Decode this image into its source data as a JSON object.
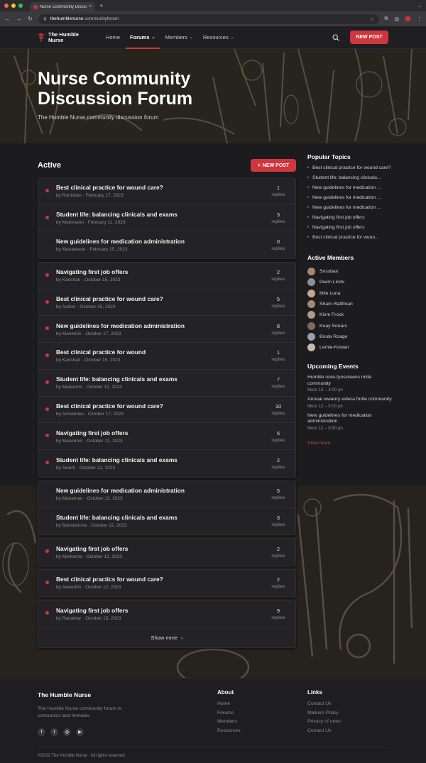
{
  "browser": {
    "tab_title": "Nurse Community Discussio",
    "tab_close": "×",
    "new_tab": "+",
    "url_domain": "thehumblenurse",
    "url_rest": ".communityforum"
  },
  "header": {
    "brand": "The Humble Nurse",
    "nav": [
      {
        "label": "Home"
      },
      {
        "label": "Forums"
      },
      {
        "label": "Members"
      },
      {
        "label": "Resources"
      }
    ],
    "new_post": "NEW POST"
  },
  "hero": {
    "title": "Nurse Community Discussion Forum",
    "subtitle": "The Humble Nurse community discussion forum"
  },
  "feed": {
    "title": "Active",
    "new_post": "NEW POST",
    "replies_label": "replies",
    "groups": [
      [
        {
          "title": "Best clinical practice for wound care?",
          "author": "Ronistian",
          "date": "February 17, 2023",
          "count": "1",
          "unread": true
        },
        {
          "title": "Student life: balancing clinicals and exams",
          "author": "Maoknann",
          "date": "February 11, 2023",
          "count": "3",
          "unread": true
        },
        {
          "title": "New guidelines for medication administration",
          "author": "Manawasin",
          "date": "February 15, 2023",
          "count": "0",
          "unread": false
        }
      ],
      [
        {
          "title": "Navigating first job offers",
          "author": "Kanshan",
          "date": "October 15, 2023",
          "count": "2",
          "unread": true
        },
        {
          "title": "Best clinical practice for wound care?",
          "author": "Author",
          "date": "October 15, 2023",
          "count": "5",
          "unread": true
        },
        {
          "title": "New guidelines for medication administration",
          "author": "Manemin",
          "date": "October 17, 2023",
          "count": "8",
          "unread": true
        },
        {
          "title": "Best clinical practice for wound",
          "author": "Kanshan",
          "date": "October 15, 2023",
          "count": "1",
          "unread": true
        },
        {
          "title": "Student life: balancing clinicals and exams",
          "author": "Maikamm",
          "date": "October 12, 2023",
          "count": "7",
          "unread": true
        },
        {
          "title": "Best clinical practice for wound care?",
          "author": "Annventex",
          "date": "October 17, 2023",
          "count": "10",
          "unread": true
        },
        {
          "title": "Navigating first job offers",
          "author": "Marxamm",
          "date": "October 12, 2023",
          "count": "5",
          "unread": true
        },
        {
          "title": "Student life: balancing clinicals and exams",
          "author": "Swerh",
          "date": "October 12, 2023",
          "count": "2",
          "unread": true
        }
      ],
      [
        {
          "title": "New guidelines for medication administration",
          "author": "Maneman",
          "date": "October 12, 2023",
          "count": "5",
          "unread": false
        },
        {
          "title": "Student life: balancing clinicals and exams",
          "author": "Banstomme",
          "date": "October 12, 2023",
          "count": "3",
          "unread": false
        }
      ],
      [
        {
          "title": "Navigating first job offers",
          "author": "Markamis",
          "date": "October 12, 2023",
          "count": "2",
          "unread": true
        }
      ],
      [
        {
          "title": "Best clinical practics for wound care?",
          "author": "Awearttin",
          "date": "October 12, 2023",
          "count": "2",
          "unread": true
        }
      ],
      [
        {
          "title": "Navigating first job offers",
          "author": "Ranathar",
          "date": "October 15, 2023",
          "count": "9",
          "unread": true
        }
      ]
    ],
    "show_more": "Show mme"
  },
  "sidebar": {
    "popular_title": "Popular Topics",
    "popular": [
      "Best clinical practice for wound care?",
      "Student life: balancing clinicals...",
      "New guidelines for medication ...",
      "New guidelines for medication ...",
      "New guidelines for medication ...",
      "Navigating first job offers",
      "Navigating first job offers",
      "Best clinical practice for woun..."
    ],
    "members_title": "Active Members",
    "members": [
      {
        "name": "Snssban",
        "color": "#a38570"
      },
      {
        "name": "Dwim Lindx",
        "color": "#8a8f9a"
      },
      {
        "name": "Mile Luna",
        "color": "#c9a48c"
      },
      {
        "name": "Sham Ratlfman",
        "color": "#9d8b80"
      },
      {
        "name": "Kism Frock",
        "color": "#b59a86"
      },
      {
        "name": "Koay Sonars",
        "color": "#7e6a5c"
      },
      {
        "name": "Bnola Roage",
        "color": "#9aa0a6"
      },
      {
        "name": "Lemie-Kowan",
        "color": "#c7b7a8"
      }
    ],
    "events_title": "Upcoming Events",
    "events": [
      {
        "title": "Humble nure-tyoscreens imite community",
        "time": "Mem 13 – 3:00 pn"
      },
      {
        "title": "Annual wwaory extera fnrite community",
        "time": "Mem 12 – 5:00 pn"
      },
      {
        "title": "New guidelines for medication administration",
        "time": "Mem 12 – 8:90 pn"
      }
    ],
    "events_more": "Slow more"
  },
  "footer": {
    "brand": "The Humble Nurse",
    "desc": "The Humble Nurse community forum is comounics and fennales",
    "socials": [
      "f",
      "t",
      "◎",
      "▶"
    ],
    "about_title": "About",
    "about": [
      "Home",
      "Forums",
      "Members",
      "Resources"
    ],
    "links_title": "Links",
    "links": [
      "Contact Us",
      "Maikers Policy",
      "Privacy of orien",
      "Contact Us"
    ],
    "copyright": "©2022 The Humble Nurse · All rights reserved"
  },
  "colors": {
    "accent": "#d0363e",
    "background": "#1b1b1e",
    "panel": "#232327"
  }
}
